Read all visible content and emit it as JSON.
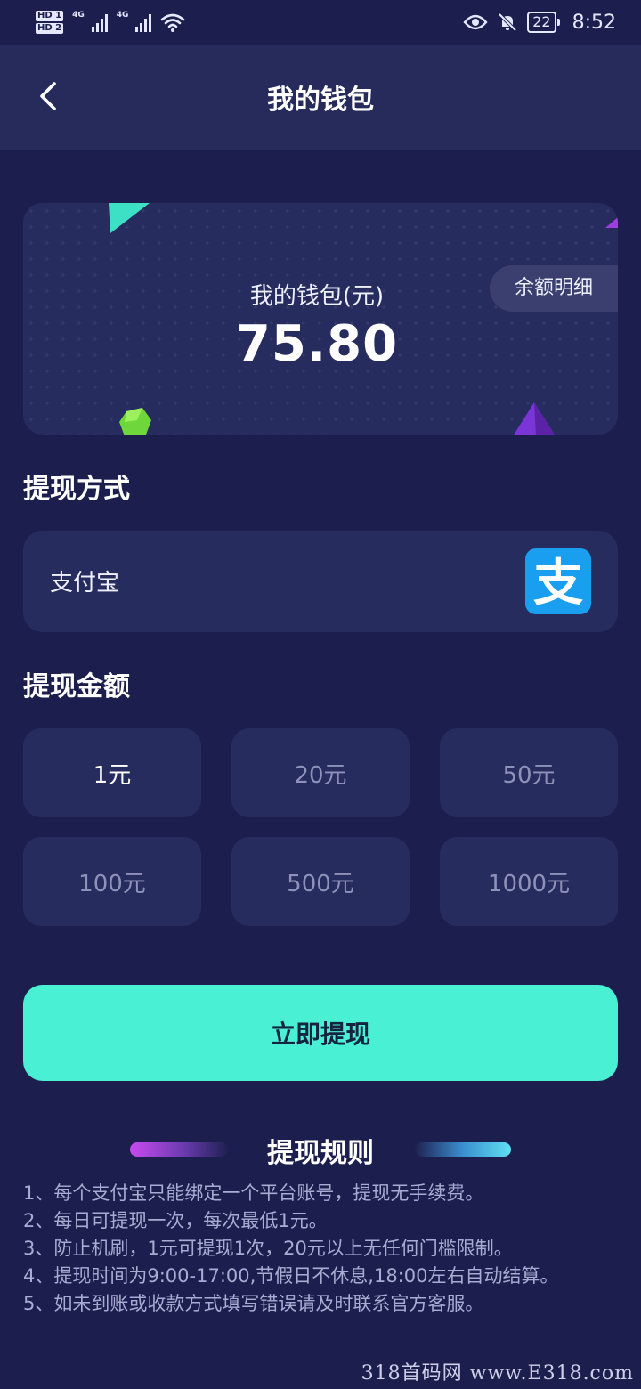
{
  "status_bar": {
    "hd1": "HD 1",
    "hd2": "HD 2",
    "net1": "4G",
    "net2": "4G",
    "battery": "22",
    "time": "8:52"
  },
  "header": {
    "title": "我的钱包"
  },
  "wallet_card": {
    "label": "我的钱包(元)",
    "amount": "75.80",
    "detail_button": "余额明细"
  },
  "withdraw_method": {
    "section_title": "提现方式",
    "method_label": "支付宝",
    "icon": "alipay-icon",
    "icon_glyph": "支"
  },
  "withdraw_amount": {
    "section_title": "提现金额",
    "options": [
      {
        "label": "1元",
        "selected": true
      },
      {
        "label": "20元",
        "selected": false
      },
      {
        "label": "50元",
        "selected": false
      },
      {
        "label": "100元",
        "selected": false
      },
      {
        "label": "500元",
        "selected": false
      },
      {
        "label": "1000元",
        "selected": false
      }
    ]
  },
  "withdraw_button": {
    "label": "立即提现"
  },
  "rules": {
    "title": "提现规则",
    "items": [
      "1、每个支付宝只能绑定一个平台账号，提现无手续费。",
      "2、每日可提现一次，每次最低1元。",
      "3、防止机刷，1元可提现1次，20元以上无任何门槛限制。",
      "4、提现时间为9:00-17:00,节假日不休息,18:00左右自动结算。",
      "5、如未到账或收款方式填写错误请及时联系官方客服。"
    ]
  },
  "watermark": "318首码网 www.E318.com",
  "colors": {
    "background": "#1c1f4d",
    "card": "#272c5e",
    "accent": "#4af0d4",
    "alipay_blue": "#1a9ff0"
  }
}
